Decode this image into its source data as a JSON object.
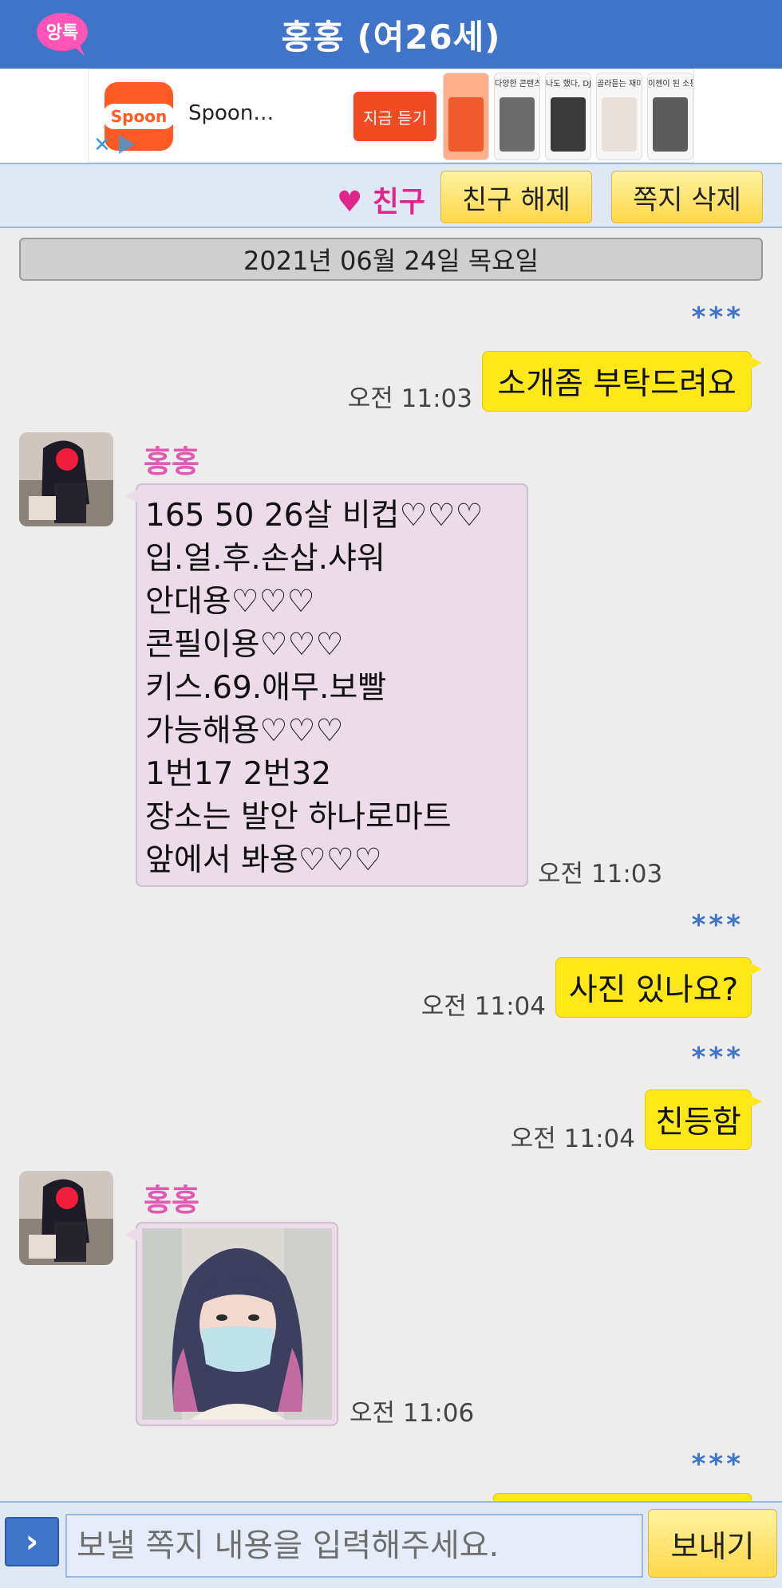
{
  "header": {
    "title": "홍홍 (여26세)",
    "logo_text": "앙톡"
  },
  "ad": {
    "brand": "Spoon",
    "name": "Spoon…",
    "cta": "지금 듣기",
    "screens": [
      "다양한 콘텐츠",
      "나도 했다, DJ",
      "골라듣는 재미",
      "이젠이 된 소통"
    ]
  },
  "friend_bar": {
    "label": "♥ 친구",
    "unfriend_button": "친구 해제",
    "delete_button": "쪽지 삭제"
  },
  "date": "2021년 06월 24일 목요일",
  "messages": [
    {
      "from": "me",
      "name": "***",
      "text": "소개좀 부탁드려요",
      "time": "오전 11:03"
    },
    {
      "from": "other",
      "name": "홍홍",
      "lines": [
        "165 50 26살 비컵♡♡♡",
        "입.얼.후.손삽.샤워",
        "안대용♡♡♡",
        "콘필이용♡♡♡",
        "키스.69.애무.보빨",
        "가능해용♡♡♡",
        "1번17 2번32",
        "장소는 발안 하나로마트",
        "앞에서 봐용♡♡♡"
      ],
      "time": "오전 11:03"
    },
    {
      "from": "me",
      "name": "***",
      "text": "사진 있나요?",
      "time": "오전 11:04"
    },
    {
      "from": "me",
      "name": "***",
      "text": "친등함",
      "time": "오전 11:04"
    },
    {
      "from": "other",
      "name": "홍홍",
      "type": "photo",
      "time": "오전 11:06"
    },
    {
      "from": "me",
      "name": "***"
    }
  ],
  "input": {
    "placeholder": "보낼 쪽지 내용을 입력해주세요.",
    "send": "보내기",
    "expand_icon": "chevron-right-icon"
  },
  "colors": {
    "header": "#3f74c8",
    "my_bubble": "#ffe817",
    "other_bubble": "#ecdbe8",
    "sender_name": "#e05ab2",
    "friend_heart": "#e0268b"
  }
}
